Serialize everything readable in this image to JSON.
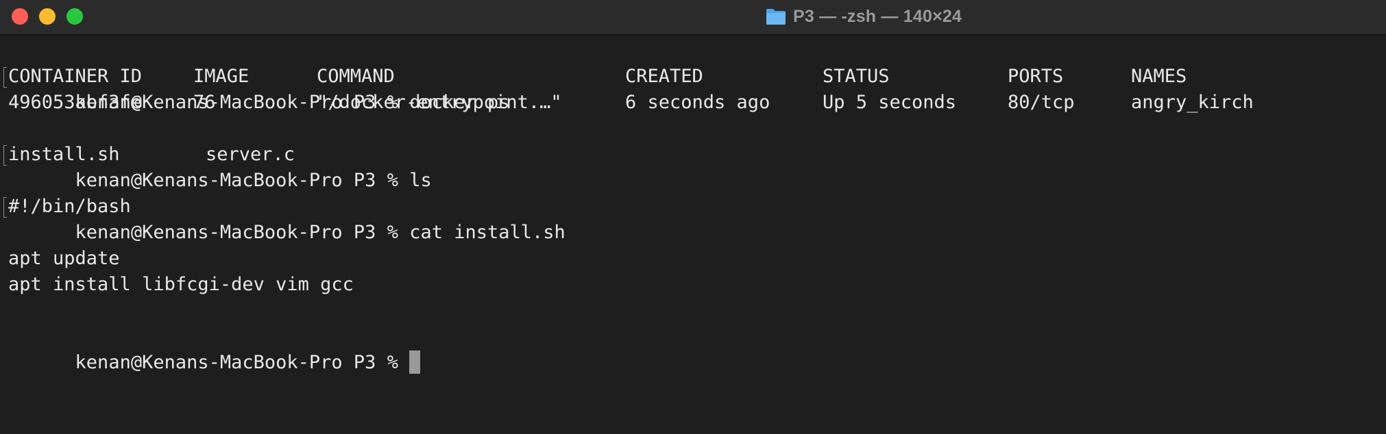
{
  "window": {
    "title": "P3 — -zsh — 140×24",
    "folder_icon": "folder-icon",
    "controls": {
      "close": "#ff5f57",
      "minimize": "#febc2e",
      "zoom": "#28c840"
    }
  },
  "terminal": {
    "prompt": "kenan@Kenans-MacBook-Pro P3 %",
    "commands": {
      "docker_ps": "docker ps",
      "ls": "ls",
      "cat": "cat install.sh"
    },
    "docker_table": {
      "headers": [
        "CONTAINER ID",
        "IMAGE",
        "COMMAND",
        "CREATED",
        "STATUS",
        "PORTS",
        "NAMES"
      ],
      "rows": [
        [
          "496053abf3fe",
          "76",
          "\"/docker-entrypoint.…\"",
          "6 seconds ago",
          "Up 5 seconds",
          "80/tcp",
          "angry_kirch"
        ]
      ]
    },
    "ls_output": [
      "install.sh",
      "server.c"
    ],
    "file_content": {
      "shebang": "#!/bin/bash",
      "line2": "apt update",
      "line3": "apt install libfcgi-dev vim gcc"
    }
  }
}
